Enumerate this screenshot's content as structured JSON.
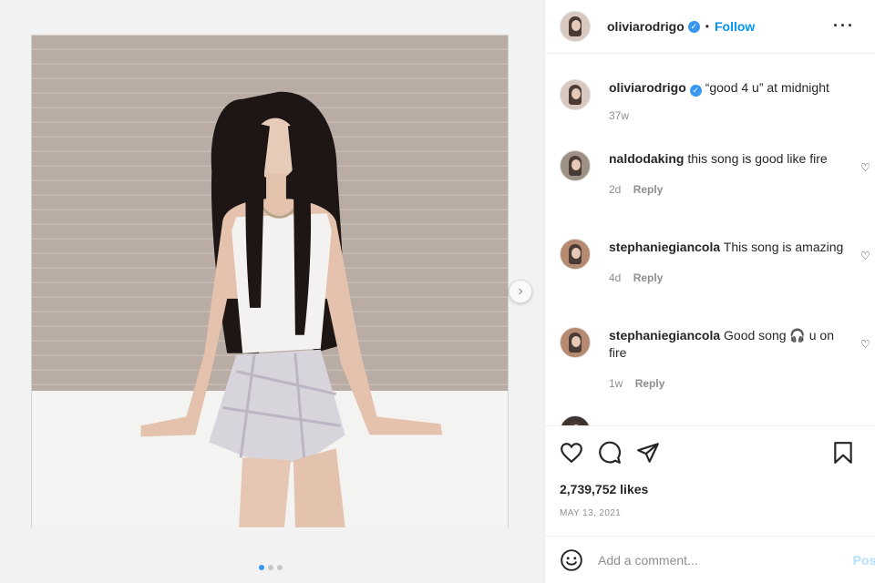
{
  "post": {
    "author": "oliviarodrigo",
    "verified_icon": "verified-badge-icon",
    "follow_label": "Follow",
    "separator": "•",
    "more_icon": "more-options-icon",
    "caption": "“good 4 u” at midnight",
    "caption_time": "37w",
    "likes": "2,739,752 likes",
    "date": "MAY 13, 2021",
    "carousel": {
      "next_icon": "chevron-right-icon",
      "slides": 3,
      "active": 1
    }
  },
  "comments": [
    {
      "user": "naldodaking",
      "text": "this song is good like fire",
      "time": "2d",
      "reply": "Reply"
    },
    {
      "user": "stephaniegiancola",
      "text": "This song is amazing",
      "time": "4d",
      "reply": "Reply"
    },
    {
      "user": "stephaniegiancola",
      "text": "Good song 🎧 u on fire",
      "time": "1w",
      "reply": "Reply"
    }
  ],
  "actions": {
    "like_icon": "heart-icon",
    "comment_icon": "comment-icon",
    "share_icon": "share-icon",
    "save_icon": "bookmark-icon"
  },
  "composer": {
    "emoji_icon": "emoji-icon",
    "placeholder": "Add a comment...",
    "post_label": "Post"
  },
  "colors": {
    "accent": "#0095f6",
    "verified": "#3897f0",
    "muted": "#8e8e8e"
  }
}
